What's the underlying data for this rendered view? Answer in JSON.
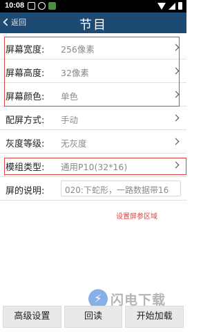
{
  "status_bar": {
    "time": "10:08"
  },
  "header": {
    "back_label": "返回",
    "title": "节目"
  },
  "settings": [
    {
      "label": "屏幕宽度:",
      "value": "256像素"
    },
    {
      "label": "屏幕高度:",
      "value": "32像素"
    },
    {
      "label": "屏幕颜色:",
      "value": "单色"
    },
    {
      "label": "配屏方式:",
      "value": "手动"
    },
    {
      "label": "灰度等级:",
      "value": "无灰度"
    },
    {
      "label": "模组类型:",
      "value": "通用P10(32*16)"
    },
    {
      "label": "屏的说明:",
      "value": "020:下蛇形，一路数据带16"
    }
  ],
  "annotation": {
    "note": "设置屏参区域",
    "color": "#e04040"
  },
  "watermark": {
    "logo": "⚡",
    "text": "闪电下载"
  },
  "buttons": {
    "advanced": "高级设置",
    "return": "回读",
    "start": "开始加载"
  },
  "colors": {
    "header_bg": "#1c4a73",
    "status_bg": "#000000"
  }
}
